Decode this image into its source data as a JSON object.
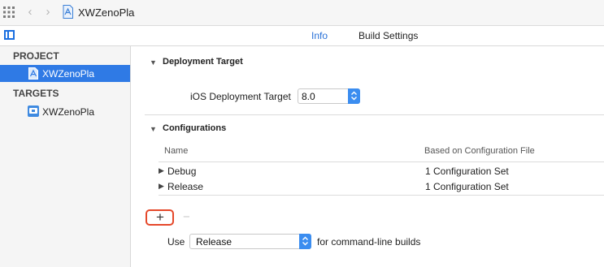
{
  "jumpbar": {
    "file_name": "XWZenoPla"
  },
  "tabs": [
    {
      "label": "Info",
      "selected": true
    },
    {
      "label": "Build Settings",
      "selected": false
    }
  ],
  "sidebar": {
    "project_header": "PROJECT",
    "project_item": "XWZenoPla",
    "targets_header": "TARGETS",
    "target_item": "XWZenoPla"
  },
  "deployment": {
    "title": "Deployment Target",
    "ios_label": "iOS Deployment Target",
    "ios_value": "8.0"
  },
  "configurations": {
    "title": "Configurations",
    "columns": [
      "Name",
      "Based on Configuration File"
    ],
    "rows": [
      {
        "name": "Debug",
        "based_on": "1 Configuration Set"
      },
      {
        "name": "Release",
        "based_on": "1 Configuration Set"
      }
    ],
    "add_symbol": "+",
    "remove_symbol": "−"
  },
  "cli_builds": {
    "prefix": "Use",
    "value": "Release",
    "suffix": "for command-line builds"
  },
  "colors": {
    "accent": "#2f7ae5",
    "highlight_border": "#e5482a",
    "tab_selected": "#2a72d8"
  }
}
